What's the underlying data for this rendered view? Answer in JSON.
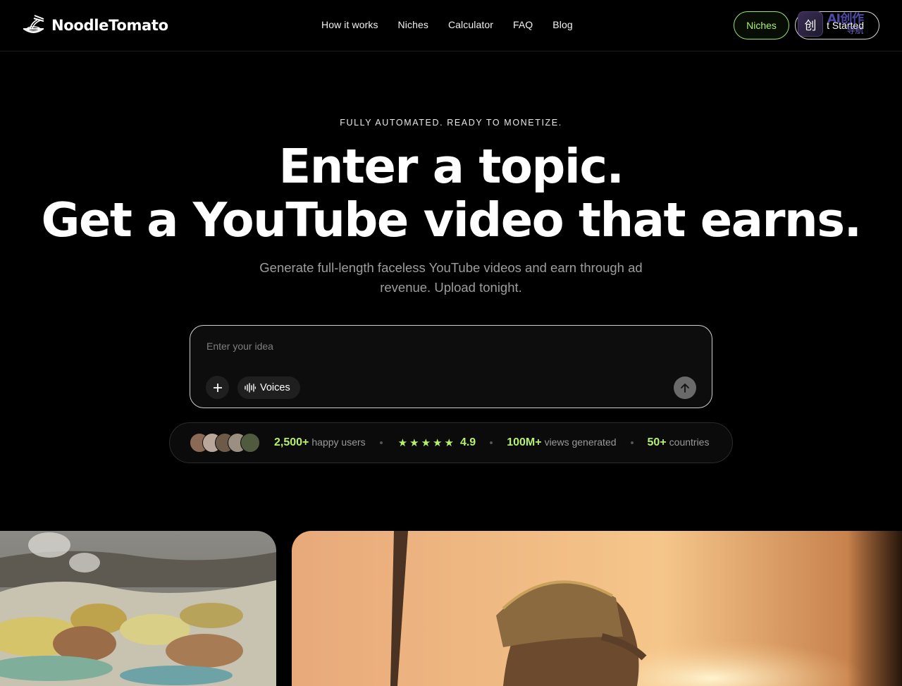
{
  "header": {
    "brand": "NoodleTomato",
    "nav": [
      "How it works",
      "Niches",
      "Calculator",
      "FAQ",
      "Blog"
    ],
    "niches_button": "Niches",
    "start_button": "t Started",
    "overlay_badge": {
      "icon_char": "创",
      "line1": "AI创作",
      "line2": "导航"
    }
  },
  "hero": {
    "eyebrow": "FULLY AUTOMATED. READY TO MONETIZE.",
    "headline_line1": "Enter a topic.",
    "headline_line2": "Get a YouTube video that earns.",
    "subhead": "Generate full-length faceless YouTube videos and earn through ad revenue. Upload tonight."
  },
  "prompt": {
    "placeholder": "Enter your idea",
    "plus_icon": "plus-icon",
    "voices_label": "Voices",
    "voices_icon": "waveform-icon",
    "send_icon": "arrow-up-icon"
  },
  "stats": {
    "avatar_colors": [
      "#8a6a55",
      "#b9a89a",
      "#6e5a48",
      "#9a8f80",
      "#4f5a3f"
    ],
    "users_value": "2,500+",
    "users_label": "happy users",
    "rating_value": "4.9",
    "star_count": 5,
    "views_value": "100M+",
    "views_label": "views generated",
    "countries_value": "50+",
    "countries_label": "countries"
  },
  "colors": {
    "accent_green": "#b6f06c",
    "niches_border": "#9be36a",
    "background": "#000000"
  }
}
